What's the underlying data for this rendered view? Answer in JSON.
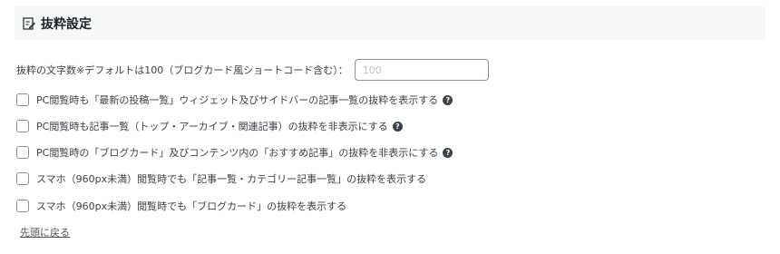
{
  "section": {
    "title": "抜粋設定",
    "icon": "edit-icon"
  },
  "excerpt_length": {
    "label": "抜粋の文字数※デフォルトは100（ブログカード風ショートコード含む）：",
    "placeholder": "100",
    "value": ""
  },
  "options": [
    {
      "label": "PC閲覧時も「最新の投稿一覧」ウィジェット及びサイドバーの記事一覧の抜粋を表示する",
      "checked": false,
      "help": "?"
    },
    {
      "label": "PC閲覧時も記事一覧（トップ・アーカイブ・関連記事）の抜粋を非表示にする",
      "checked": false,
      "help": "?"
    },
    {
      "label": "PC閲覧時の「ブログカード」及びコンテンツ内の「おすすめ記事」の抜粋を非表示にする",
      "checked": false,
      "help": "?"
    },
    {
      "label": "スマホ（960px未満）閲覧時でも「記事一覧・カテゴリー記事一覧」の抜粋を表示する",
      "checked": false
    },
    {
      "label": "スマホ（960px未満）閲覧時でも「ブログカード」の抜粋を表示する",
      "checked": false
    }
  ],
  "back_to_top": "先頭に戻る"
}
